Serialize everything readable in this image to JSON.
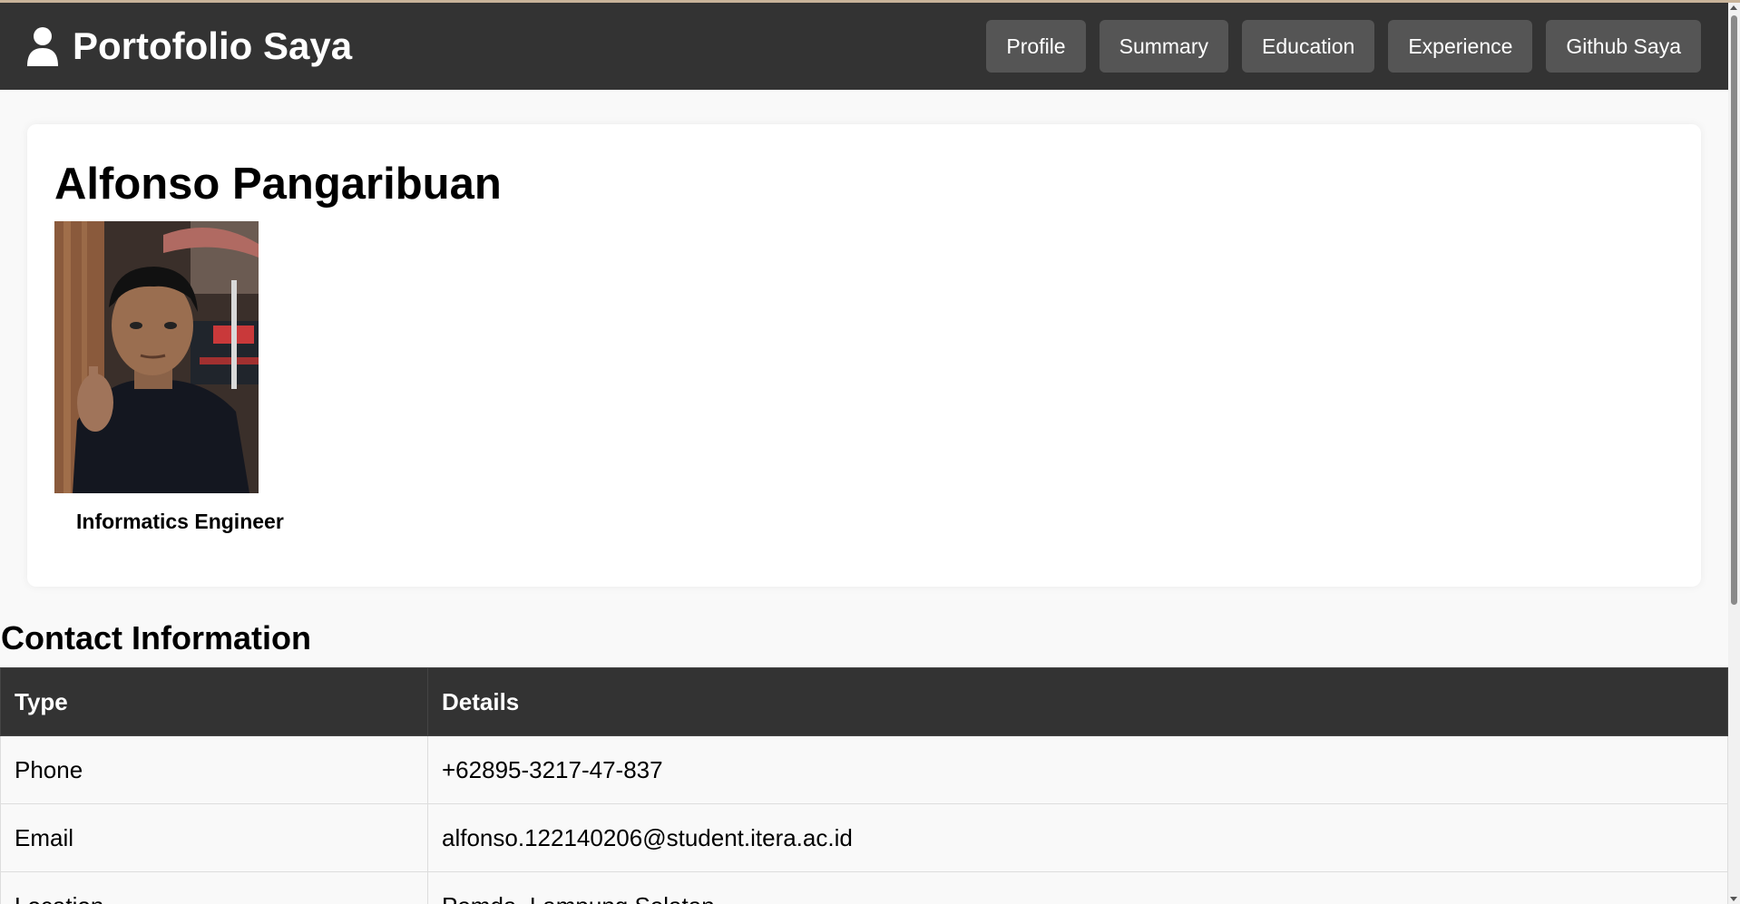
{
  "navbar": {
    "brand": "Portofolio Saya",
    "brand_icon": "user-icon",
    "links": [
      "Profile",
      "Summary",
      "Education",
      "Experience",
      "Github Saya"
    ]
  },
  "profile": {
    "name": "Alfonso Pangaribuan",
    "role": "Informatics Engineer"
  },
  "contact": {
    "title": "Contact Information",
    "headers": [
      "Type",
      "Details"
    ],
    "rows": [
      [
        "Phone",
        "+62895-3217-47-837"
      ],
      [
        "Email",
        "alfonso.122140206@student.itera.ac.id"
      ],
      [
        "Location",
        "Pemda, Lampung Selatan"
      ]
    ]
  },
  "colors": {
    "navbar": "#333333",
    "nav_button": "#555555",
    "page_background": "#f9f9f9"
  }
}
